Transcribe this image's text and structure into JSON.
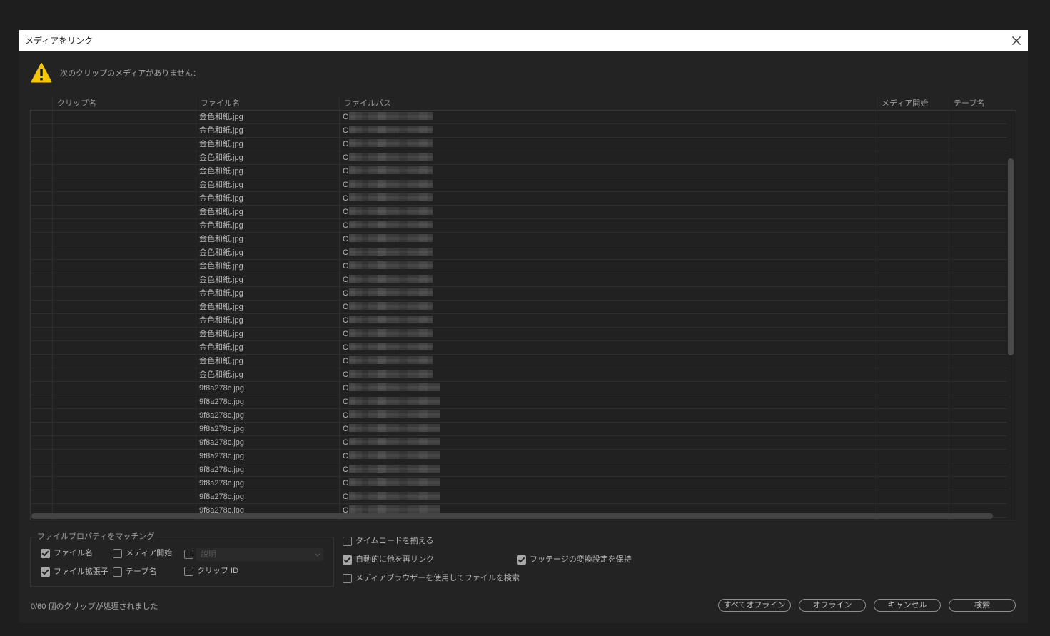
{
  "window": {
    "title": "メディアをリンク"
  },
  "icons": {
    "close": "close-icon",
    "warning": "warning-icon",
    "dropdown": "chevron-down-icon"
  },
  "colors": {
    "warning": "#f6c500"
  },
  "message": {
    "text": "次のクリップのメディアがありません："
  },
  "table": {
    "columns": {
      "clip_name": "クリップ名",
      "file_name": "ファイル名",
      "file_path": "ファイルパス",
      "media_start": "メディア開始",
      "tape_name": "テープ名"
    },
    "rows": [
      {
        "file_name": "金色和紙.jpg",
        "file_path": "C"
      },
      {
        "file_name": "金色和紙.jpg",
        "file_path": "C"
      },
      {
        "file_name": "金色和紙.jpg",
        "file_path": "C"
      },
      {
        "file_name": "金色和紙.jpg",
        "file_path": "C"
      },
      {
        "file_name": "金色和紙.jpg",
        "file_path": "C"
      },
      {
        "file_name": "金色和紙.jpg",
        "file_path": "C"
      },
      {
        "file_name": "金色和紙.jpg",
        "file_path": "C"
      },
      {
        "file_name": "金色和紙.jpg",
        "file_path": "C"
      },
      {
        "file_name": "金色和紙.jpg",
        "file_path": "C"
      },
      {
        "file_name": "金色和紙.jpg",
        "file_path": "C"
      },
      {
        "file_name": "金色和紙.jpg",
        "file_path": "C"
      },
      {
        "file_name": "金色和紙.jpg",
        "file_path": "C"
      },
      {
        "file_name": "金色和紙.jpg",
        "file_path": "C"
      },
      {
        "file_name": "金色和紙.jpg",
        "file_path": "C"
      },
      {
        "file_name": "金色和紙.jpg",
        "file_path": "C"
      },
      {
        "file_name": "金色和紙.jpg",
        "file_path": "C"
      },
      {
        "file_name": "金色和紙.jpg",
        "file_path": "C"
      },
      {
        "file_name": "金色和紙.jpg",
        "file_path": "C"
      },
      {
        "file_name": "金色和紙.jpg",
        "file_path": "C"
      },
      {
        "file_name": "金色和紙.jpg",
        "file_path": "C"
      },
      {
        "file_name": "9f8a278c.jpg",
        "file_path": "C"
      },
      {
        "file_name": "9f8a278c.jpg",
        "file_path": "C"
      },
      {
        "file_name": "9f8a278c.jpg",
        "file_path": "C"
      },
      {
        "file_name": "9f8a278c.jpg",
        "file_path": "C"
      },
      {
        "file_name": "9f8a278c.jpg",
        "file_path": "C"
      },
      {
        "file_name": "9f8a278c.jpg",
        "file_path": "C"
      },
      {
        "file_name": "9f8a278c.jpg",
        "file_path": "C"
      },
      {
        "file_name": "9f8a278c.jpg",
        "file_path": "C"
      },
      {
        "file_name": "9f8a278c.jpg",
        "file_path": "C"
      },
      {
        "file_name": "9f8a278c.jpg",
        "file_path": "C"
      }
    ]
  },
  "match": {
    "legend": "ファイルプロパティをマッチング",
    "file_name": {
      "label": "ファイル名",
      "checked": true
    },
    "media_start": {
      "label": "メディア開始",
      "checked": false
    },
    "description": {
      "checked": false,
      "disabled": true,
      "select_value": "説明"
    },
    "file_extension": {
      "label": "ファイル拡張子",
      "checked": true
    },
    "tape_name": {
      "label": "テープ名",
      "checked": false
    },
    "clip_id": {
      "label": "クリップ ID",
      "checked": false
    }
  },
  "options": {
    "align_timecode": {
      "label": "タイムコードを揃える",
      "checked": false
    },
    "relink_others": {
      "label": "自動的に他を再リンク",
      "checked": true
    },
    "preserve_interpret": {
      "label": "フッテージの変換設定を保持",
      "checked": true
    },
    "use_media_browser": {
      "label": "メディアブラウザーを使用してファイルを検索",
      "checked": false
    }
  },
  "status": "0/60 個のクリップが処理されました",
  "buttons": {
    "offline_all": "すべてオフライン",
    "offline": "オフライン",
    "cancel": "キャンセル",
    "search": "検索"
  }
}
